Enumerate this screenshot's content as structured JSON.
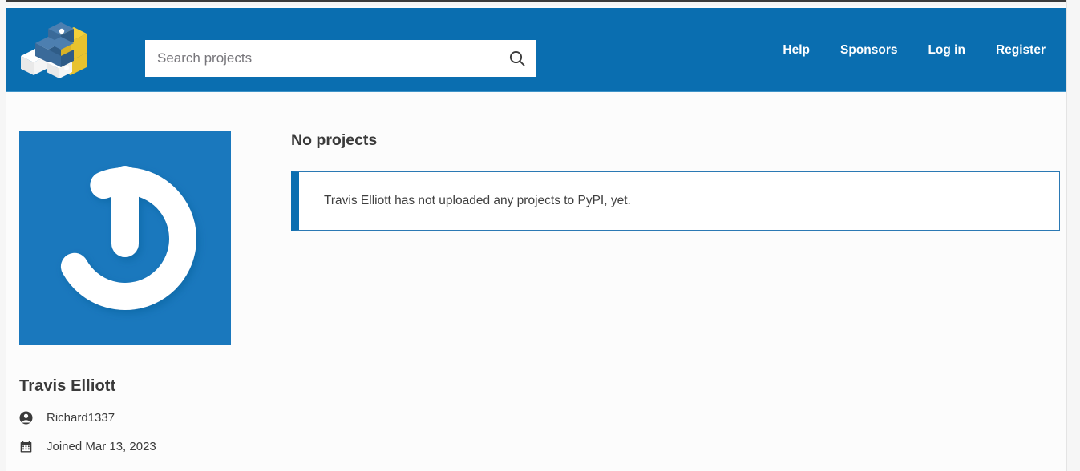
{
  "header": {
    "logo_icon": "pypi-cubes-logo",
    "search": {
      "placeholder": "Search projects",
      "value": "",
      "icon": "search-icon"
    },
    "nav": [
      {
        "label": "Help"
      },
      {
        "label": "Sponsors"
      },
      {
        "label": "Log in"
      },
      {
        "label": "Register"
      }
    ]
  },
  "sidebar": {
    "avatar": {
      "icon": "gravatar-default-avatar",
      "background_color": "#1a78bd",
      "glyph_color": "#ffffff"
    },
    "name": "Travis Elliott",
    "meta": [
      {
        "icon": "user-circle-icon",
        "label": "Richard1337"
      },
      {
        "icon": "calendar-icon",
        "label": "Joined Mar 13, 2023"
      }
    ]
  },
  "main": {
    "heading": "No projects",
    "callout": {
      "text": "Travis Elliott has not uploaded any projects to PyPI, yet.",
      "accent_color": "#0a6eb0",
      "border_color": "#2b79b4"
    }
  },
  "colors": {
    "header_background": "#0a6eb0",
    "page_background": "#fcfcfc",
    "text": "#3a3a3a",
    "link_white": "#ffffff"
  }
}
